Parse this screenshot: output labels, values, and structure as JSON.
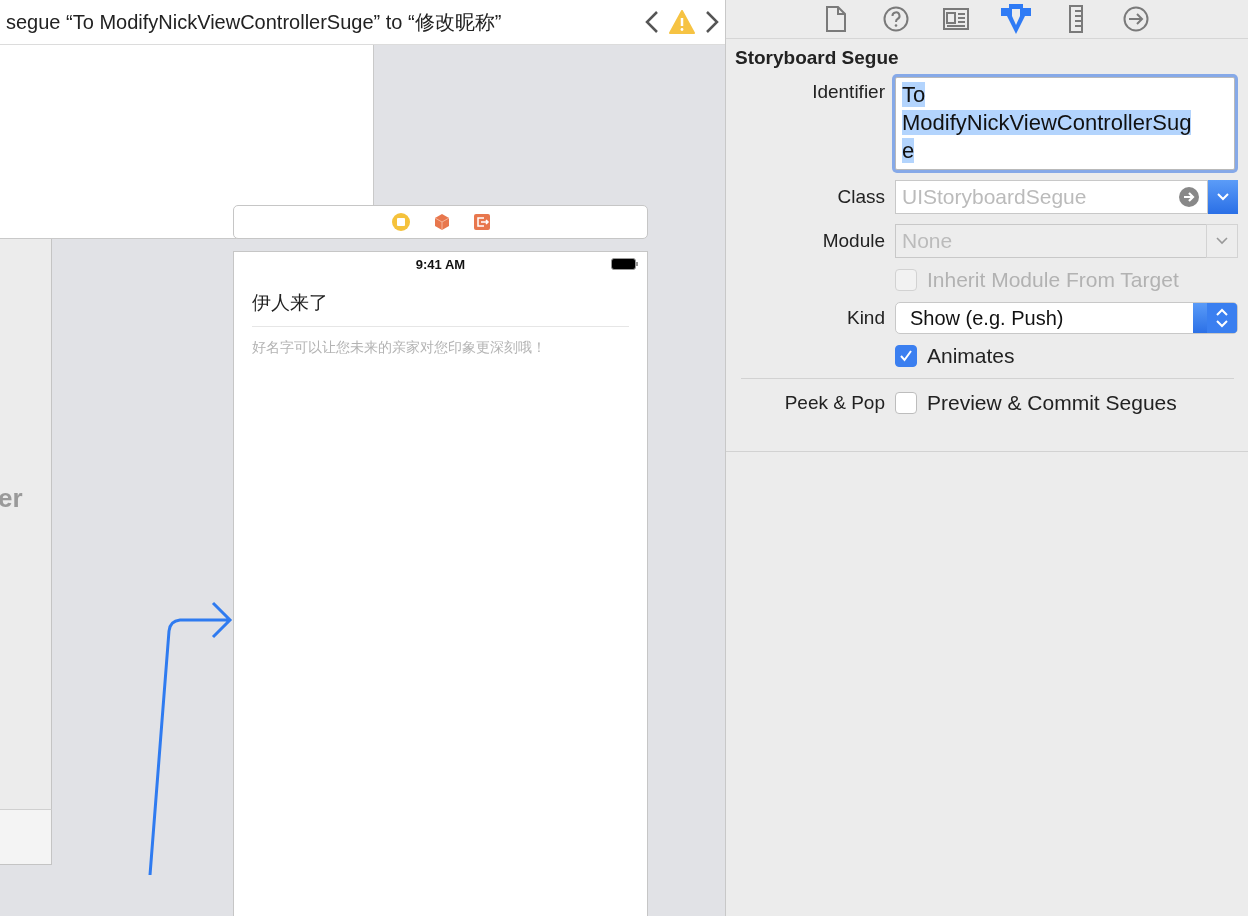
{
  "editor": {
    "jump_bar": {
      "title": "segue “To ModifyNickViewControllerSuge” to “修改昵称”",
      "warning": true
    }
  },
  "canvas": {
    "partial_scene_label": "er",
    "destination_scene": {
      "status_time": "9:41 AM",
      "title": "伊人来了",
      "hint": "好名字可以让您未来的亲家对您印象更深刻哦！"
    }
  },
  "inspector": {
    "tabs": [
      {
        "kind": "file",
        "selected": false
      },
      {
        "kind": "help",
        "selected": false
      },
      {
        "kind": "identity",
        "selected": false
      },
      {
        "kind": "attributes",
        "selected": true
      },
      {
        "kind": "size",
        "selected": false
      },
      {
        "kind": "connections",
        "selected": false
      }
    ],
    "section_title": "Storyboard Segue",
    "identifier": {
      "label": "Identifier",
      "value": "To ModifyNickViewControllerSuge",
      "focused": true
    },
    "class_field": {
      "label": "Class",
      "placeholder": "UIStoryboardSegue"
    },
    "module": {
      "label": "Module",
      "placeholder": "None"
    },
    "inherit": {
      "label": "Inherit Module From Target",
      "checked": false,
      "disabled": true
    },
    "kind": {
      "label": "Kind",
      "value": "Show (e.g. Push)"
    },
    "animates": {
      "label": "Animates",
      "checked": true,
      "disabled": false
    },
    "peek_pop": {
      "label": "Peek & Pop",
      "option": "Preview & Commit Segues",
      "checked": false,
      "disabled": false
    }
  }
}
